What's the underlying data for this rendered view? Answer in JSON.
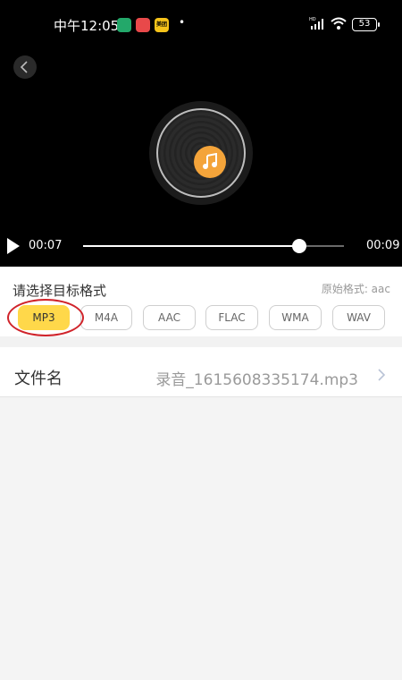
{
  "status_bar": {
    "time": "中午12:05",
    "notifications": [
      "",
      "",
      "美团"
    ],
    "dot": "•",
    "battery": "53",
    "signal_label": "HD"
  },
  "player": {
    "current_time": "00:07",
    "total_time": "00:09",
    "progress": 0.83
  },
  "format": {
    "title": "请选择目标格式",
    "original": "原始格式: aac",
    "options": [
      "MP3",
      "M4A",
      "AAC",
      "FLAC",
      "WMA",
      "WAV"
    ],
    "selected": "MP3"
  },
  "file": {
    "label": "文件名",
    "value": "录音_1615608335174.mp3"
  },
  "colors": {
    "accent": "#ffd84a",
    "disc_center": "#f4a43a",
    "highlight": "#d0232a"
  }
}
